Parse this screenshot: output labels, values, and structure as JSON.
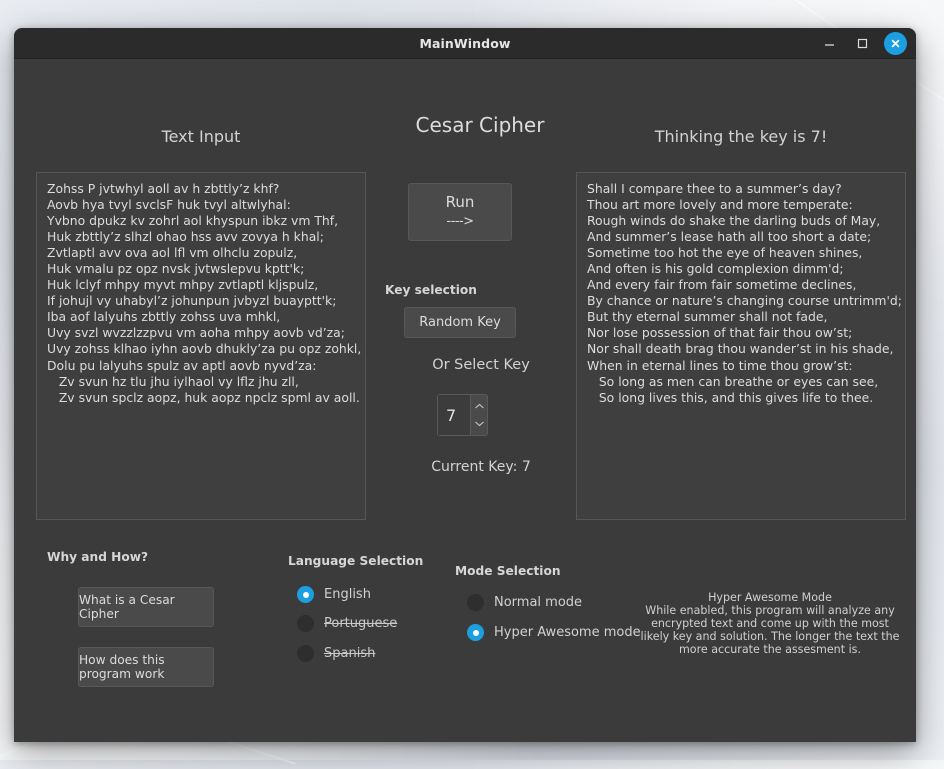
{
  "window": {
    "title": "MainWindow",
    "controls": {
      "minimize": "minimize-button",
      "maximize": "maximize-button",
      "close": "close-button"
    },
    "close_color": "#1c9fe0"
  },
  "columns": {
    "input_header": "Text Input",
    "center_header": "Cesar Cipher",
    "output_header": "Thinking the key is 7!"
  },
  "input_text": "Zohss P jvtwhyl aoll av h zbttly’z khf?\nAovb hya tvyl svclsF huk tvyl altwlyhal:\nYvbno dpukz kv zohrl aol khyspun ibkz vm Thf,\nHuk zbttly’z slhzl ohao hss avv zovya h khal;\nZvtlaptl avv ova aol lfl vm olhclu zopulz,\nHuk vmalu pz opz nvsk jvtwslepvu kptt'k;\nHuk lclyf mhpy myvt mhpy zvtlaptl kljspulz,\nIf johujl vy uhabyl’z johunpun jvbyzl buayptt'k;\nIba aof lalyuhs zbttly zohss uva mhkl,\nUvy svzl wvzzlzzpvu vm aoha mhpy aovb vd’za;\nUvy zohss klhao iyhn aovb dhukly’za pu opz zohkl,\nDolu pu lalyuhs spulz av aptl aovb nyvd’za:\n   Zv svun hz tlu jhu iylhaol vy lflz jhu zll,\n   Zv svun spclz aopz, huk aopz npclz spml av aoll.",
  "output_text": "Shall I compare thee to a summer’s day?\nThou art more lovely and more temperate:\nRough winds do shake the darling buds of May,\nAnd summer’s lease hath all too short a date;\nSometime too hot the eye of heaven shines,\nAnd often is his gold complexion dimm'd;\nAnd every fair from fair sometime declines,\nBy chance or nature’s changing course untrimm'd;\nBut thy eternal summer shall not fade,\nNor lose possession of that fair thou ow’st;\nNor shall death brag thou wander’st in his shade,\nWhen in eternal lines to time thou grow’st:\n   So long as men can breathe or eyes can see,\n   So long lives this, and this gives life to thee.",
  "run": {
    "label": "Run",
    "arrow": "---->"
  },
  "key_selection": {
    "header": "Key selection",
    "random_button": "Random Key",
    "or_select_label": "Or Select Key",
    "spin_value": "7",
    "current_key_label": "Current Key: 7"
  },
  "why_and_how": {
    "header": "Why and How?",
    "buttons": [
      "What is a Cesar Cipher",
      "How does this program work"
    ]
  },
  "language_selection": {
    "header": "Language Selection",
    "options": [
      {
        "label": "English",
        "checked": true,
        "disabled": false
      },
      {
        "label": "Portuguese",
        "checked": false,
        "disabled": true
      },
      {
        "label": "Spanish",
        "checked": false,
        "disabled": true
      }
    ]
  },
  "mode_selection": {
    "header": "Mode Selection",
    "options": [
      {
        "label": "Normal mode",
        "checked": false
      },
      {
        "label": "Hyper Awesome mode",
        "checked": true
      }
    ]
  },
  "mode_description": "Hyper Awesome Mode\nWhile enabled, this program will analyze any\nencrypted text and come up with the most\nlikely key and solution. The longer the text the\nmore accurate the assesment is."
}
